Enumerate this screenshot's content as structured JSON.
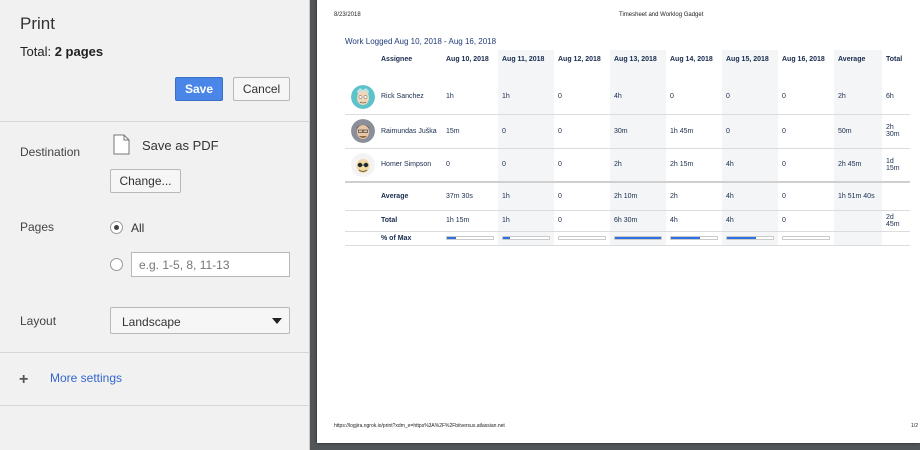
{
  "print_panel": {
    "title": "Print",
    "total_label": "Total:",
    "total_value": "2 pages",
    "save_label": "Save",
    "cancel_label": "Cancel",
    "destination_label": "Destination",
    "destination_value": "Save as PDF",
    "change_label": "Change...",
    "pages_label": "Pages",
    "pages_all_label": "All",
    "pages_custom_placeholder": "e.g. 1-5, 8, 11-13",
    "layout_label": "Layout",
    "layout_value": "Landscape",
    "more_settings_label": "More settings",
    "accent_color": "#4a86e8"
  },
  "preview": {
    "header_date": "8/23/2018",
    "header_title": "Timesheet and Worklog Gadget",
    "footer_url": "https://logjira.ngrok.io/print?xdm_e=https%3A%2F%2Fbitversus.atlassian.net",
    "footer_page": "1/2",
    "gadget_title": "Work Logged Aug 10, 2018 - Aug 16, 2018",
    "columns": [
      "Assignee",
      "Aug 10, 2018",
      "Aug 11, 2018",
      "Aug 12, 2018",
      "Aug 13, 2018",
      "Aug 14, 2018",
      "Aug 15, 2018",
      "Aug 16, 2018",
      "Average",
      "Total"
    ],
    "rows": [
      {
        "name": "Rick Sanchez",
        "avatar": "rick-avatar",
        "cells": [
          "1h",
          "1h",
          "0",
          "4h",
          "0",
          "0",
          "0",
          "2h",
          "6h"
        ]
      },
      {
        "name": "Raimundas Juška",
        "avatar": "raimundas-avatar",
        "cells": [
          "15m",
          "0",
          "0",
          "30m",
          "1h 45m",
          "0",
          "0",
          "50m",
          "2h 30m"
        ]
      },
      {
        "name": "Homer Simpson",
        "avatar": "homer-avatar",
        "cells": [
          "0",
          "0",
          "0",
          "2h",
          "2h 15m",
          "4h",
          "0",
          "2h 45m",
          "1d 15m"
        ]
      }
    ],
    "average_row": {
      "label": "Average",
      "cells": [
        "37m 30s",
        "1h",
        "0",
        "2h 10m",
        "2h",
        "4h",
        "0",
        "1h 51m 40s",
        ""
      ]
    },
    "total_row": {
      "label": "Total",
      "cells": [
        "1h 15m",
        "1h",
        "0",
        "6h 30m",
        "4h",
        "4h",
        "0",
        "",
        "2d 45m"
      ]
    },
    "percent_row": {
      "label": "% of Max",
      "percents": [
        19,
        15,
        0,
        100,
        62,
        62,
        0
      ]
    },
    "bar_color": "#2f6fdf"
  }
}
